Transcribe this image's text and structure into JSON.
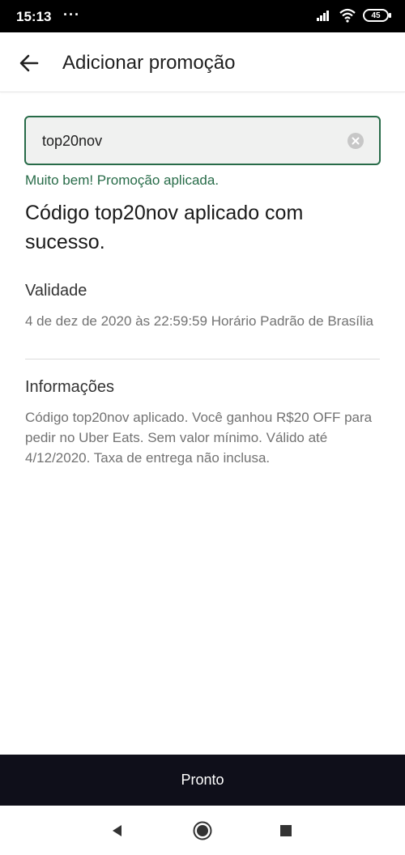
{
  "status_bar": {
    "time": "15:13",
    "dots": "···",
    "battery": "45"
  },
  "header": {
    "title": "Adicionar promoção",
    "back_icon": "arrow-left-icon"
  },
  "promo": {
    "input_value": "top20nov",
    "clear_icon": "clear-circle-icon",
    "success_message": "Muito bem! Promoção aplicada.",
    "headline": "Código top20nov aplicado com sucesso."
  },
  "validity": {
    "label": "Validade",
    "text": "4 de dez de 2020 às 22:59:59 Horário Padrão de Brasília"
  },
  "info": {
    "label": "Informações",
    "text": "Código top20nov aplicado. Você ganhou R$20 OFF para pedir no Uber Eats. Sem valor mínimo. Válido até 4/12/2020. Taxa de entrega não inclusa."
  },
  "footer": {
    "done_label": "Pronto"
  },
  "colors": {
    "accent": "#276b48",
    "button_bg": "#0f0f1a",
    "input_bg": "#f0f1f0"
  },
  "nav_icons": [
    "back-triangle-icon",
    "home-circle-icon",
    "recents-square-icon"
  ]
}
